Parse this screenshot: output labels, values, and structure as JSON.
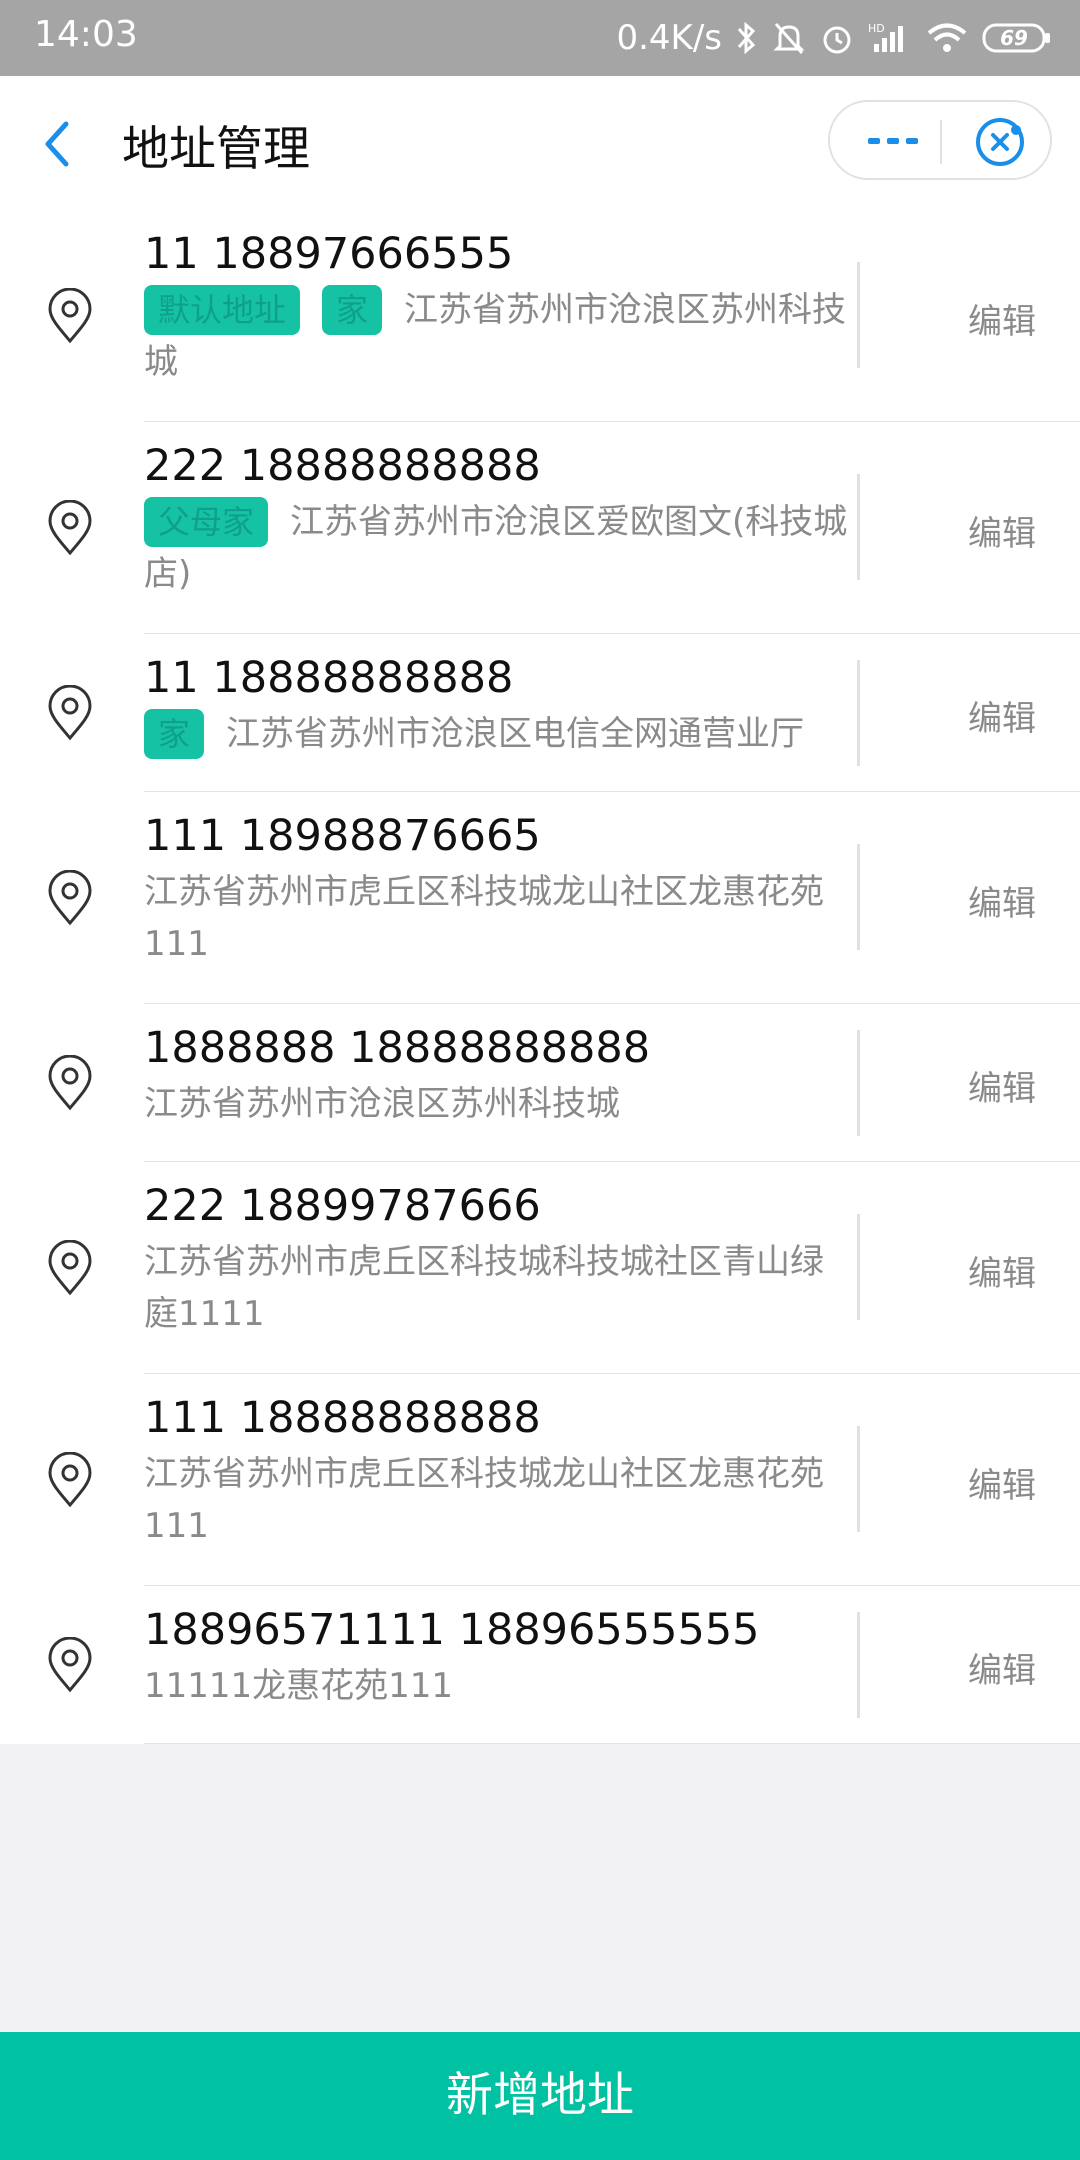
{
  "status_bar": {
    "time": "14:03",
    "net_speed": "0.4K/s",
    "battery": "69"
  },
  "nav": {
    "title": "地址管理"
  },
  "addresses": [
    {
      "title": "11 18897666555",
      "tags": [
        "默认地址",
        "家"
      ],
      "address": "江苏省苏州市沧浪区苏州科技城",
      "edit_label": "编辑"
    },
    {
      "title": "222 18888888888",
      "tags": [
        "父母家"
      ],
      "address": "江苏省苏州市沧浪区爱欧图文(科技城店)",
      "edit_label": "编辑"
    },
    {
      "title": "11 18888888888",
      "tags": [
        "家"
      ],
      "address": "江苏省苏州市沧浪区电信全网通营业厅",
      "edit_label": "编辑"
    },
    {
      "title": "111 18988876665",
      "tags": [],
      "address": "江苏省苏州市虎丘区科技城龙山社区龙惠花苑111",
      "edit_label": "编辑"
    },
    {
      "title": "1888888 18888888888",
      "tags": [],
      "address": "江苏省苏州市沧浪区苏州科技城",
      "edit_label": "编辑"
    },
    {
      "title": "222 18899787666",
      "tags": [],
      "address": "江苏省苏州市虎丘区科技城科技城社区青山绿庭1111",
      "edit_label": "编辑"
    },
    {
      "title": "111 18888888888",
      "tags": [],
      "address": "江苏省苏州市虎丘区科技城龙山社区龙惠花苑111",
      "edit_label": "编辑"
    },
    {
      "title": "18896571111 18896555555",
      "tags": [],
      "address": "11111龙惠花苑111",
      "edit_label": "编辑"
    }
  ],
  "bottom": {
    "add_label": "新增地址"
  },
  "colors": {
    "accent": "#00c2a3",
    "tag_bg": "#16c2a4",
    "link_blue": "#1a8ee8"
  }
}
